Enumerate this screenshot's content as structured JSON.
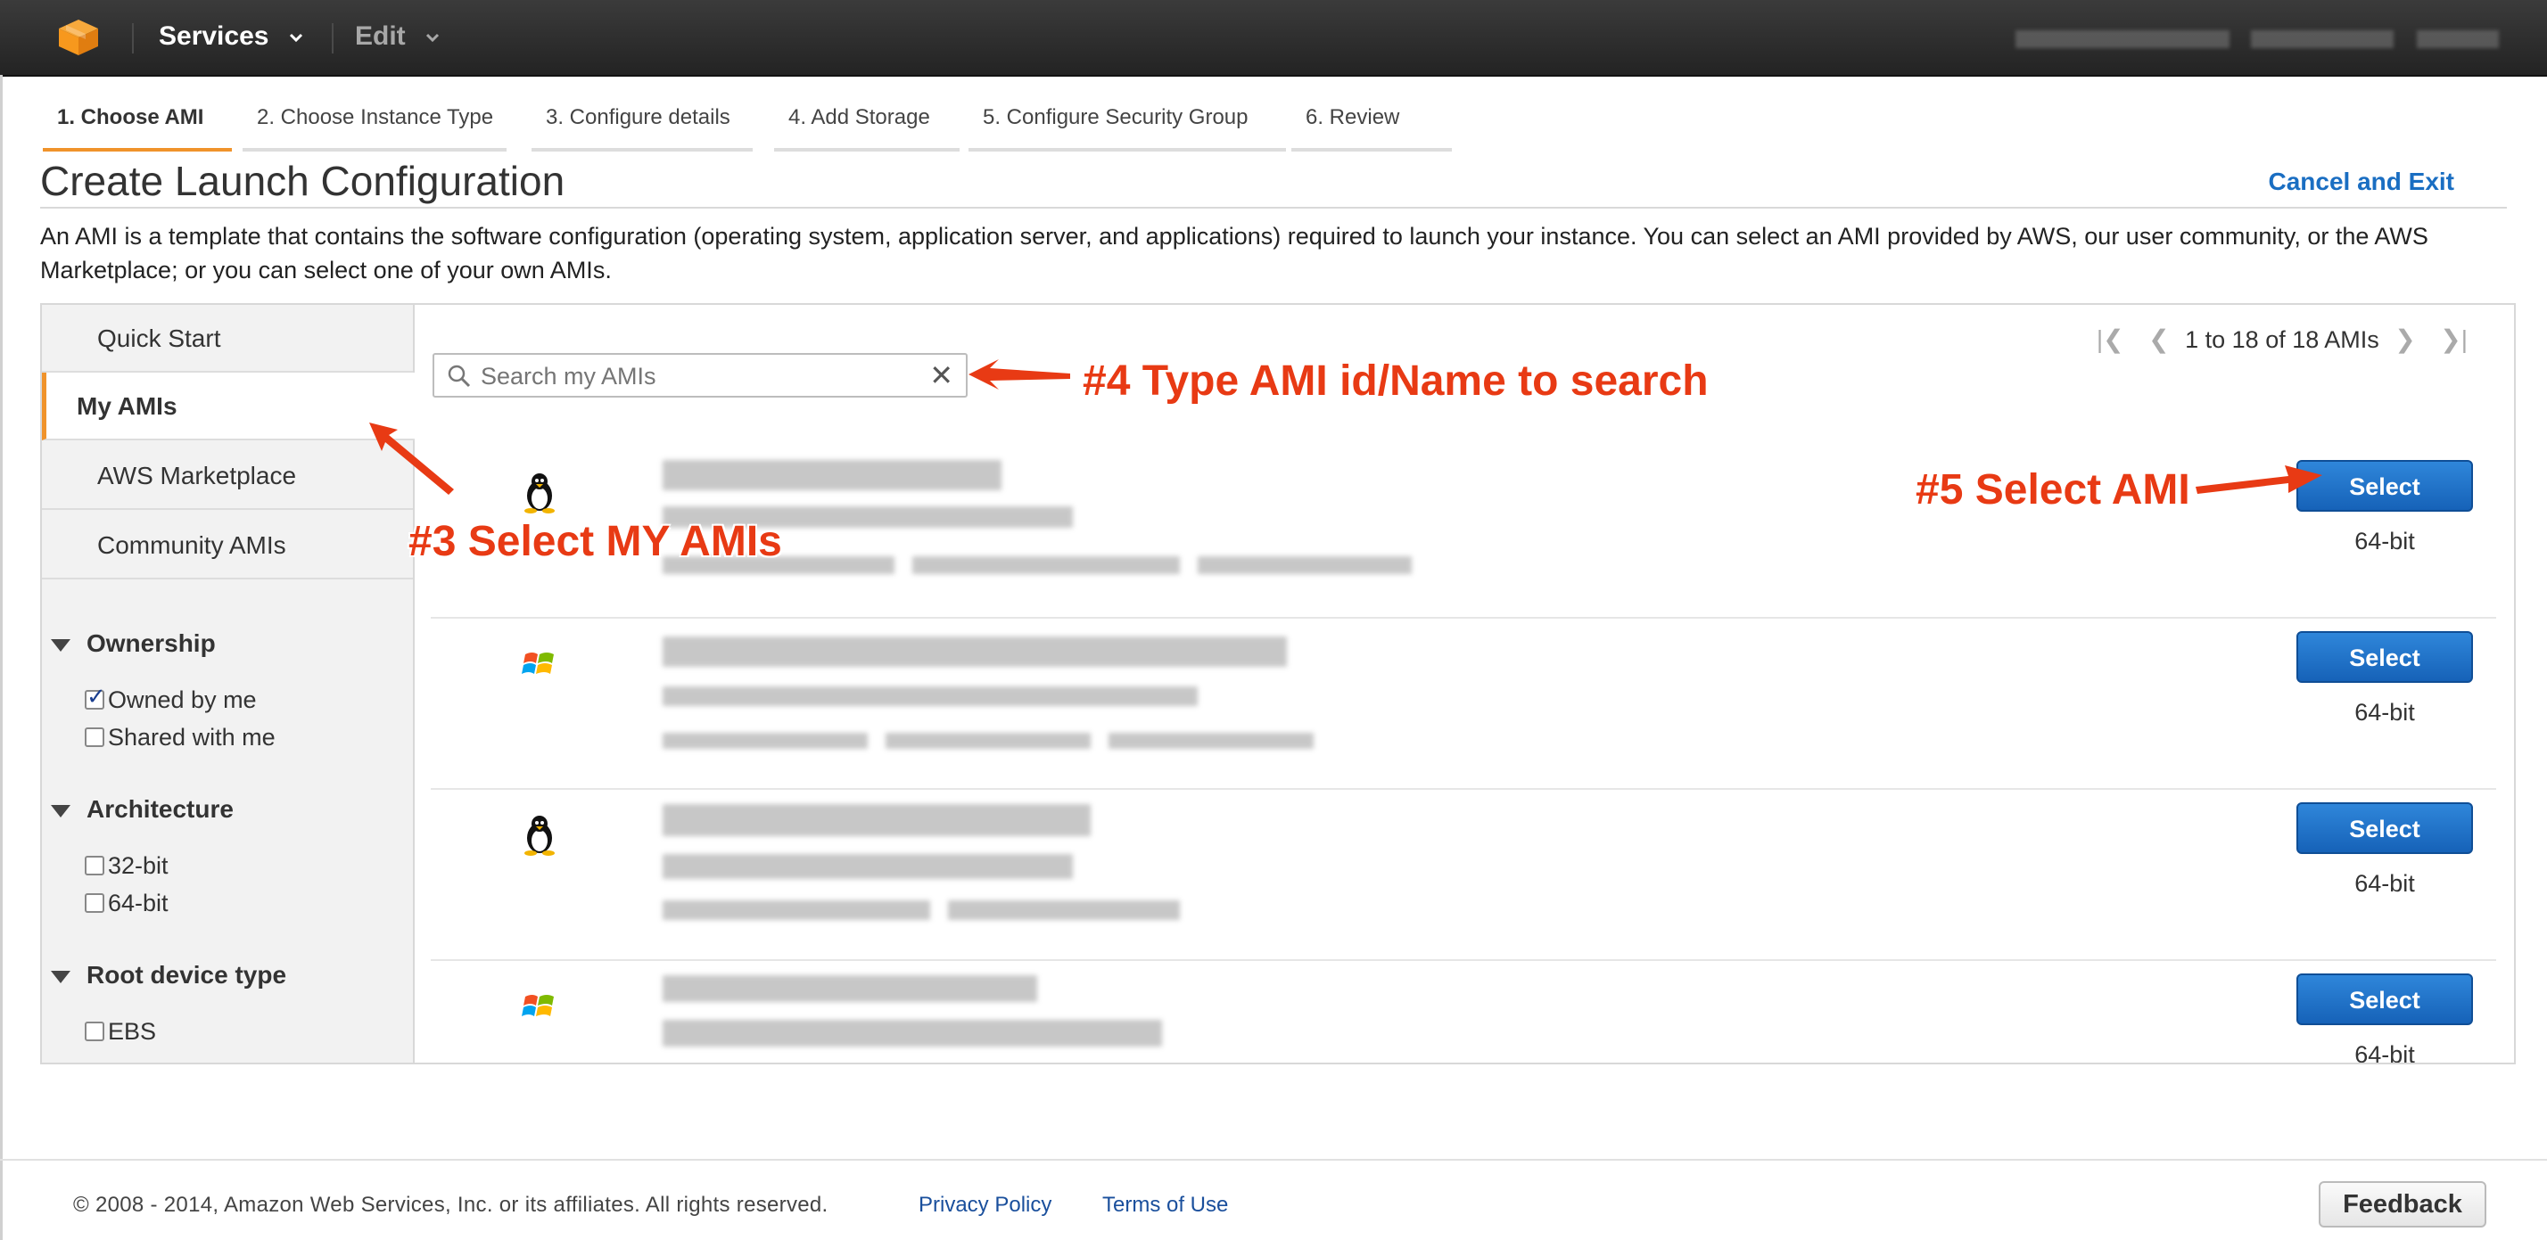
{
  "topnav": {
    "services_label": "Services",
    "edit_label": "Edit",
    "logo_color": "#f7981d"
  },
  "wizard": {
    "steps": [
      {
        "label": "1. Choose AMI",
        "active": true
      },
      {
        "label": "2. Choose Instance Type",
        "active": false
      },
      {
        "label": "3. Configure details",
        "active": false
      },
      {
        "label": "4. Add Storage",
        "active": false
      },
      {
        "label": "5. Configure Security Group",
        "active": false
      },
      {
        "label": "6. Review",
        "active": false
      }
    ]
  },
  "page": {
    "title": "Create Launch Configuration",
    "cancel_exit": "Cancel and Exit",
    "intro": "An AMI is a template that contains the software configuration (operating system, application server, and applications) required to launch your instance. You can select an AMI provided by AWS, our user community, or the AWS Marketplace; or you can select one of your own AMIs."
  },
  "sidebar": {
    "items": [
      {
        "label": "Quick Start",
        "active": false
      },
      {
        "label": "My AMIs",
        "active": true
      },
      {
        "label": "AWS Marketplace",
        "active": false
      },
      {
        "label": "Community AMIs",
        "active": false
      }
    ],
    "filters": {
      "ownership": {
        "title": "Ownership",
        "options": [
          {
            "label": "Owned by me",
            "checked": true
          },
          {
            "label": "Shared with me",
            "checked": false
          }
        ]
      },
      "architecture": {
        "title": "Architecture",
        "options": [
          {
            "label": "32-bit",
            "checked": false
          },
          {
            "label": "64-bit",
            "checked": false
          }
        ]
      },
      "root_device": {
        "title": "Root device type",
        "options": [
          {
            "label": "EBS",
            "checked": false
          }
        ]
      }
    }
  },
  "search": {
    "placeholder": "Search my AMIs"
  },
  "pagination": {
    "summary": "1 to 18 of 18 AMIs"
  },
  "amis": [
    {
      "os_icon": "linux-icon",
      "select_label": "Select",
      "arch": "64-bit"
    },
    {
      "os_icon": "windows-icon",
      "select_label": "Select",
      "arch": "64-bit"
    },
    {
      "os_icon": "linux-icon",
      "select_label": "Select",
      "arch": "64-bit"
    },
    {
      "os_icon": "windows-icon",
      "select_label": "Select",
      "arch": "64-bit"
    }
  ],
  "annotations": {
    "step3": "#3 Select MY AMIs",
    "step4": "#4 Type AMI id/Name to search",
    "step5": "#5 Select AMI",
    "color": "#e83a14"
  },
  "footer": {
    "copyright": "© 2008 - 2014, Amazon Web Services, Inc. or its affiliates. All rights reserved.",
    "privacy": "Privacy Policy",
    "terms": "Terms of Use",
    "feedback": "Feedback"
  }
}
